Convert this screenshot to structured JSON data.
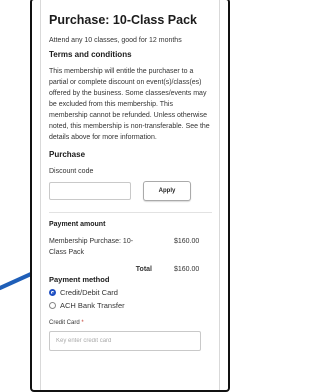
{
  "title": "Purchase: 10-Class Pack",
  "subtitle": "Attend any 10 classes, good for 12 months",
  "terms": {
    "heading": "Terms and conditions",
    "text": "This membership will entitle the purchaser to a partial or complete discount on event(s)/class(es) offered by the business. Some classes/events may be excluded from this membership. This membership cannot be refunded. Unless otherwise noted, this membership is non-transferable. See the details above for more information."
  },
  "purchase": {
    "heading": "Purchase",
    "discount_label": "Discount code",
    "discount_value": "",
    "apply_label": "Apply"
  },
  "payment_amount": {
    "heading": "Payment amount",
    "item": "Membership Purchase: 10-Class Pack",
    "item_price": "$160.00",
    "total_label": "Total",
    "total_value": "$160.00"
  },
  "payment_method": {
    "heading": "Payment method",
    "options": [
      "Credit/Debit Card",
      "ACH Bank Transfer"
    ],
    "selected": "Credit/Debit Card"
  },
  "credit_card": {
    "label": "Credit Card",
    "required_marker": "*",
    "placeholder": "Key enter credit card"
  },
  "colors": {
    "accent": "#1e4fc2",
    "pointer": "#1f5fb8",
    "required": "#c0392b"
  }
}
